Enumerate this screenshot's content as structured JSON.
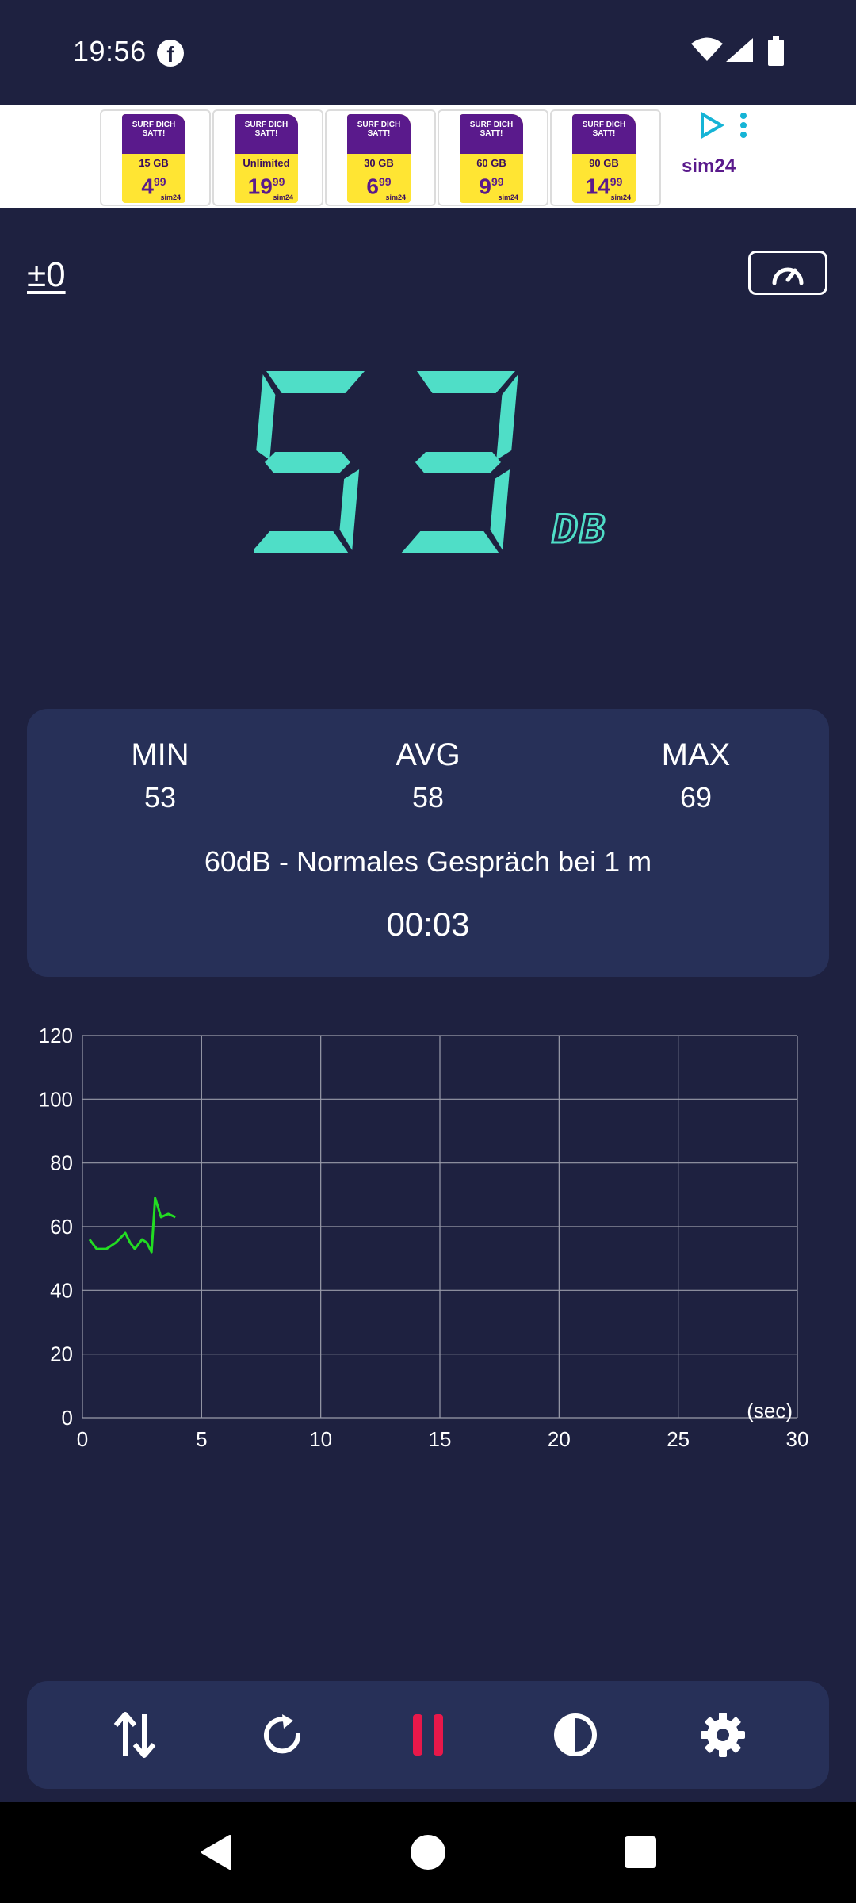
{
  "status_bar": {
    "time": "19:56",
    "notification_icon": "facebook-icon",
    "icons": [
      "wifi-icon",
      "signal-icon",
      "battery-icon"
    ]
  },
  "ad": {
    "cards": [
      {
        "top": "SURF DICH SATT!",
        "gb": "15 GB",
        "price": "4",
        "cents": "99",
        "brand": "sim24"
      },
      {
        "top": "SURF DICH SATT!",
        "gb": "Unlimited",
        "price": "19",
        "cents": "99",
        "brand": "sim24"
      },
      {
        "top": "SURF DICH SATT!",
        "gb": "30 GB",
        "price": "6",
        "cents": "99",
        "brand": "sim24"
      },
      {
        "top": "SURF DICH SATT!",
        "gb": "60 GB",
        "price": "9",
        "cents": "99",
        "brand": "sim24"
      },
      {
        "top": "SURF DICH SATT!",
        "gb": "90 GB",
        "price": "14",
        "cents": "99",
        "brand": "sim24"
      }
    ],
    "brand_logo": "sim24",
    "colors": {
      "purple": "#5a1a8c",
      "yellow": "#ffe533",
      "play": "#16b4d6"
    }
  },
  "controls": {
    "offset_label": "±0",
    "meter_icon": "speedometer-icon"
  },
  "reading": {
    "value": "53",
    "unit": "DB",
    "color": "#4fdec7"
  },
  "stats": {
    "min_label": "MIN",
    "min_value": "53",
    "avg_label": "AVG",
    "avg_value": "58",
    "max_label": "MAX",
    "max_value": "69",
    "description": "60dB - Normales Gespräch bei 1 m",
    "timer": "00:03"
  },
  "chart_data": {
    "type": "line",
    "x_unit_label": "(sec)",
    "xlim": [
      0,
      30
    ],
    "ylim": [
      0,
      120
    ],
    "xticks": [
      0,
      5,
      10,
      15,
      20,
      25,
      30
    ],
    "yticks": [
      0,
      20,
      40,
      60,
      80,
      100,
      120
    ],
    "grid": true,
    "series": [
      {
        "color": "#22dd22",
        "x": [
          0.3,
          0.6,
          1.0,
          1.4,
          1.8,
          2.0,
          2.2,
          2.5,
          2.7,
          2.9,
          3.05,
          3.3,
          3.6,
          3.9
        ],
        "values": [
          56,
          53,
          53,
          55,
          58,
          55,
          53,
          56,
          55,
          52,
          69,
          63,
          64,
          63
        ]
      }
    ]
  },
  "toolbar": {
    "buttons": [
      {
        "name": "sort-arrows-icon",
        "color": "#ffffff"
      },
      {
        "name": "refresh-icon",
        "color": "#ffffff"
      },
      {
        "name": "pause-icon",
        "color": "#e8184a"
      },
      {
        "name": "contrast-icon",
        "color": "#ffffff"
      },
      {
        "name": "settings-gear-icon",
        "color": "#ffffff"
      }
    ]
  },
  "nav_bar": {
    "buttons": [
      "back-icon",
      "home-icon",
      "recents-icon"
    ]
  }
}
